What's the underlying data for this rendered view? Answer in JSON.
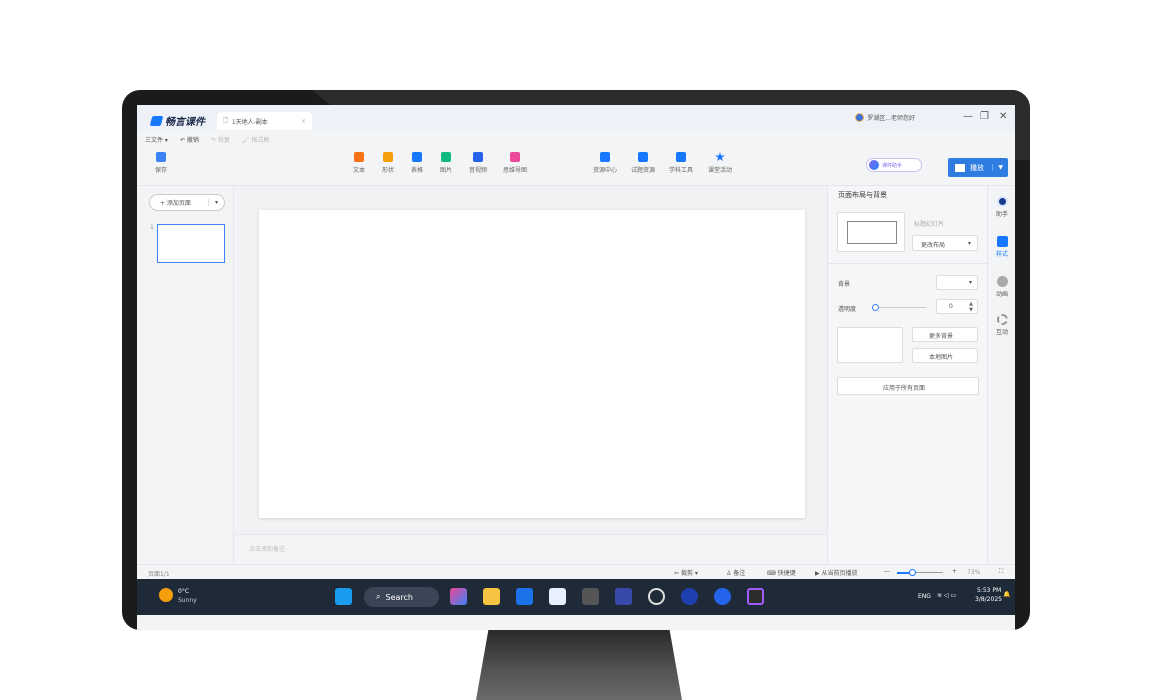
{
  "titlebar": {
    "app_name": "畅言课件",
    "doc_tab": "1天地人-副本",
    "close_tab": "×",
    "user_text": "罗湖区...老师您好",
    "min": "—",
    "max": "❐",
    "close": "✕"
  },
  "menu": {
    "file": "三文件",
    "undo": "撤销",
    "redo": "恢复",
    "format_painter": "格式刷"
  },
  "toolbar": {
    "save": "保存",
    "text": "文本",
    "shape": "形状",
    "table": "表格",
    "image": "图片",
    "media": "音视频",
    "mindmap": "思维导图",
    "resource_center": "资源中心",
    "question_bank": "试题资源",
    "subject_tools": "学科工具",
    "class_activity": "课堂活动",
    "assistant": "课件助手",
    "play": "播放"
  },
  "sidebar": {
    "add_page": "+ 添加页面",
    "thumb_index": "1"
  },
  "canvas": {
    "notes_placeholder": "点击添加备注"
  },
  "rpanel": {
    "title": "页面布局与背景",
    "layout_name": "标题幻灯片",
    "change_layout": "更改布局",
    "background": "背景",
    "transparency": "透明度",
    "transparency_value": "0",
    "more_bg": "更多背景",
    "local_image": "本地图片",
    "apply_all": "应用于所有页面"
  },
  "rtabs": {
    "assistant": "助手",
    "style": "样式",
    "animation": "动画",
    "interact": "互动"
  },
  "status": {
    "page": "页面1/1",
    "crop": "裁剪",
    "notes": "备注",
    "shortcut": "快捷键",
    "play_current": "从当前页播放",
    "zoom": "73%"
  },
  "taskbar": {
    "temp": "0°C",
    "weather": "Sunny",
    "search": "Search",
    "lang": "ENG",
    "time": "5:53 PM",
    "date": "3/8/2025"
  },
  "colors": {
    "accent": "#2f7de1",
    "taskbar": "#1f2a38"
  }
}
